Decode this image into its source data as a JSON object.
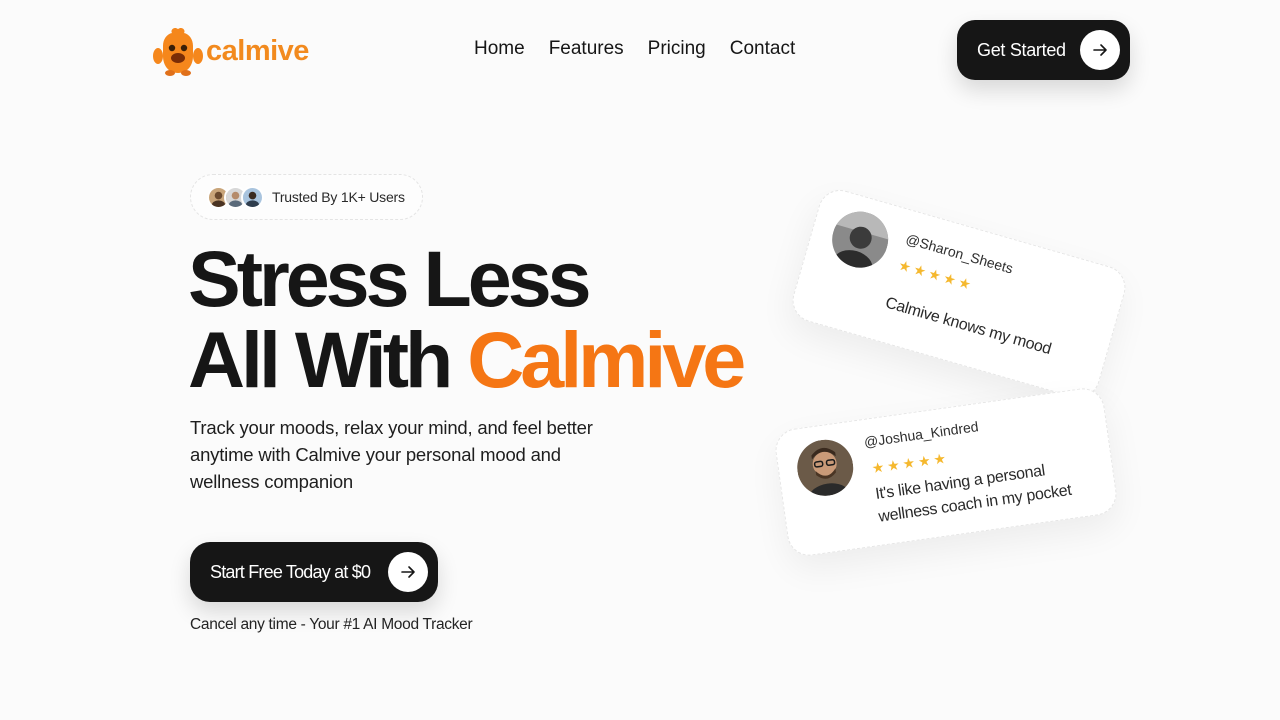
{
  "brand": {
    "name": "calmive",
    "logo_icon": "orange-mascot-icon",
    "accent_color": "#f57614",
    "logo_color": "#f28a1e"
  },
  "nav": {
    "items": [
      "Home",
      "Features",
      "Pricing",
      "Contact"
    ]
  },
  "header_cta": {
    "label": "Get Started",
    "icon": "arrow-right-icon"
  },
  "trusted": {
    "label": "Trusted By 1K+ Users"
  },
  "hero": {
    "title_line1": "Stress Less",
    "title_line2_prefix": "All With ",
    "title_line2_accent": "Calmive",
    "subtitle": "Track your moods, relax your mind, and feel better anytime with Calmive your personal mood and wellness companion",
    "cta_label": "Start Free Today at $0",
    "note": "Cancel any time - Your #1 AI Mood Tracker"
  },
  "reviews": [
    {
      "handle": "@Sharon_Sheets",
      "stars": 5,
      "quote": "Calmive knows my mood"
    },
    {
      "handle": "@Joshua_Kindred",
      "stars": 5,
      "quote": "It's like having a personal wellness coach in my pocket"
    }
  ]
}
